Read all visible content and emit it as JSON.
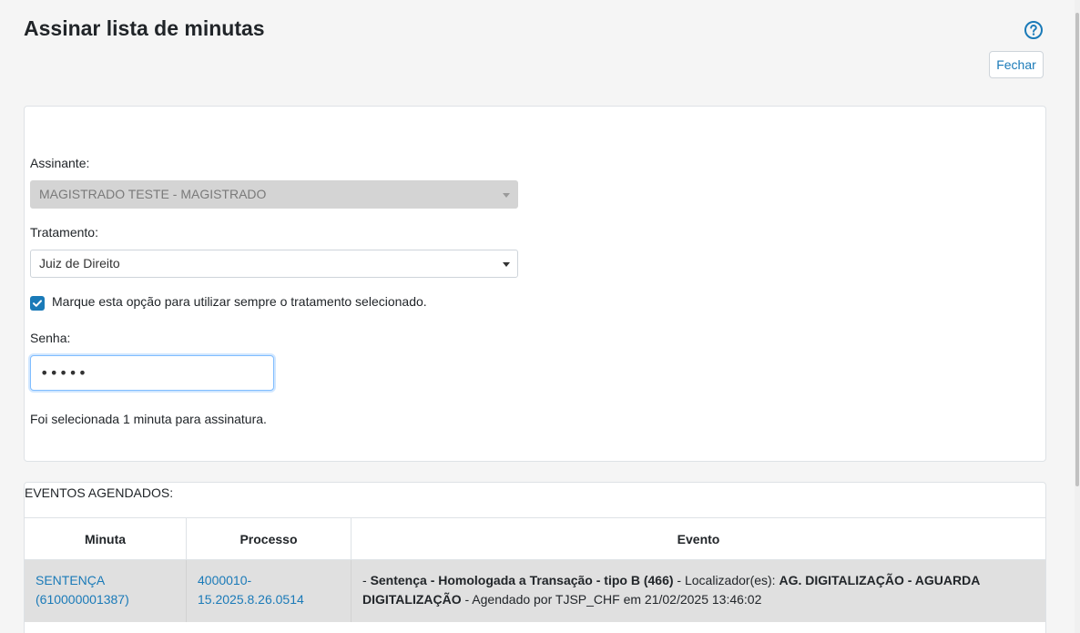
{
  "page": {
    "title": "Assinar lista de minutas",
    "close_label": "Fechar",
    "help_icon": "question-circle-icon"
  },
  "form": {
    "signer_label": "Assinante:",
    "signer_value": "MAGISTRADO TESTE - MAGISTRADO",
    "treatment_label": "Tratamento:",
    "treatment_value": "Juiz de Direito",
    "always_use_checked": true,
    "always_use_label": "Marque esta opção para utilizar sempre o tratamento selecionado.",
    "password_label": "Senha:",
    "password_value": "12345",
    "info_text": "Foi selecionada 1 minuta para assinatura."
  },
  "events": {
    "title": "EVENTOS AGENDADOS:",
    "columns": [
      "Minuta",
      "Processo",
      "Evento"
    ],
    "rows": [
      {
        "minuta_name": "SENTENÇA",
        "minuta_id": "(610000001387)",
        "processo_part1": "4000010-",
        "processo_part2": "15.2025.8.26.0514",
        "evento_prefix": "- ",
        "evento_name": "Sentença - Homologada a Transação - tipo B (466)",
        "evento_locator_label": " - Localizador(es): ",
        "evento_locator": "AG. DIGITALIZAÇÃO - AGUARDA DIGITALIZAÇÃO",
        "evento_scheduled": " - Agendado por TJSP_CHF em 21/02/2025 13:46:02"
      }
    ]
  },
  "colors": {
    "accent": "#1a7ab8",
    "row_background": "#e0e0e0",
    "disabled_select": "#d4d4d4"
  }
}
